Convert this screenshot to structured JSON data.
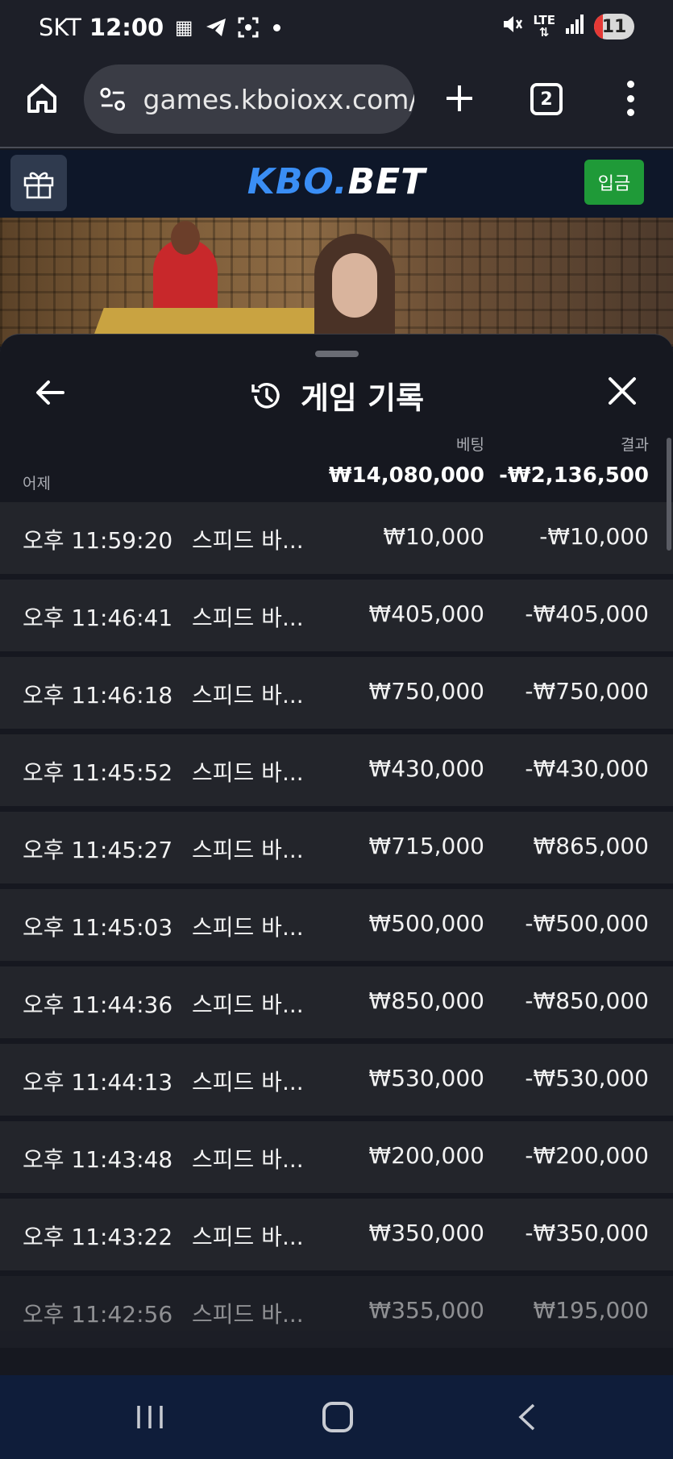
{
  "status_bar": {
    "carrier": "SKT",
    "time": "12:00",
    "network": "LTE",
    "battery": "11"
  },
  "browser": {
    "url": "games.kboioxx.com/",
    "tab_count": "2"
  },
  "site": {
    "logo_part1": "KBO.",
    "logo_part2": "BET",
    "deposit_label": "입금"
  },
  "panel": {
    "title": "게임 기록",
    "bet_header": "베팅",
    "result_header": "결과",
    "date_label": "어제",
    "total_bet": "₩14,080,000",
    "total_result": "-₩2,136,500"
  },
  "rows": [
    {
      "time": "오후 11:59:20",
      "game": "스피드 바...",
      "bet": "₩10,000",
      "result": "-₩10,000"
    },
    {
      "time": "오후 11:46:41",
      "game": "스피드 바...",
      "bet": "₩405,000",
      "result": "-₩405,000"
    },
    {
      "time": "오후 11:46:18",
      "game": "스피드 바...",
      "bet": "₩750,000",
      "result": "-₩750,000"
    },
    {
      "time": "오후 11:45:52",
      "game": "스피드 바...",
      "bet": "₩430,000",
      "result": "-₩430,000"
    },
    {
      "time": "오후 11:45:27",
      "game": "스피드 바...",
      "bet": "₩715,000",
      "result": "₩865,000"
    },
    {
      "time": "오후 11:45:03",
      "game": "스피드 바...",
      "bet": "₩500,000",
      "result": "-₩500,000"
    },
    {
      "time": "오후 11:44:36",
      "game": "스피드 바...",
      "bet": "₩850,000",
      "result": "-₩850,000"
    },
    {
      "time": "오후 11:44:13",
      "game": "스피드 바...",
      "bet": "₩530,000",
      "result": "-₩530,000"
    },
    {
      "time": "오후 11:43:48",
      "game": "스피드 바...",
      "bet": "₩200,000",
      "result": "-₩200,000"
    },
    {
      "time": "오후 11:43:22",
      "game": "스피드 바...",
      "bet": "₩350,000",
      "result": "-₩350,000"
    },
    {
      "time": "오후 11:42:56",
      "game": "스피드 바...",
      "bet": "₩355,000",
      "result": "₩195,000"
    }
  ],
  "colors": {
    "accent_blue": "#3a8ef5",
    "deposit_green": "#1f9a38",
    "battery_red": "#e53935"
  }
}
